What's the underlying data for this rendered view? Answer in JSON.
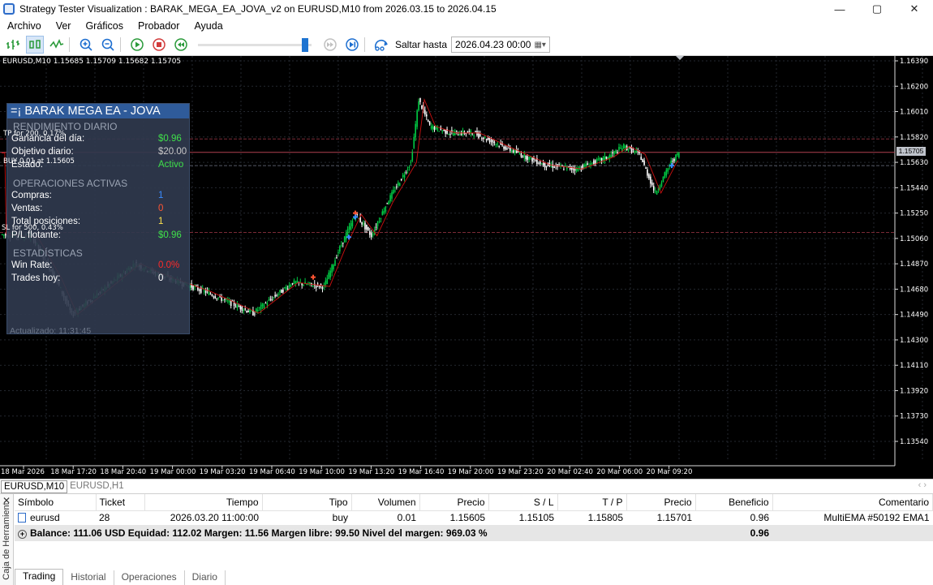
{
  "window": {
    "title": "Strategy Tester Visualization : BARAK_MEGA_EA_JOVA_v2 on EURUSD,M10 from 2026.03.15 to 2026.04.15",
    "btn_min": "—",
    "btn_max": "▢",
    "btn_close": "✕"
  },
  "menu": [
    "Archivo",
    "Ver",
    "Gráficos",
    "Probador",
    "Ayuda"
  ],
  "toolbar": {
    "saltar_label": "Saltar hasta",
    "saltar_value": "2026.04.23 00:00",
    "slider_position": 0.97
  },
  "chart": {
    "symbol_line": "EURUSD,M10  1.15685 1.15709 1.15682 1.15705",
    "price_labels": [
      "1.16390",
      "1.16200",
      "1.16010",
      "1.15820",
      "1.15630",
      "1.15440",
      "1.15250",
      "1.15060",
      "1.14870",
      "1.14680",
      "1.14490",
      "1.14300",
      "1.14110",
      "1.13920",
      "1.13730",
      "1.13540"
    ],
    "current_price": "1.15705",
    "time_labels": [
      "18 Mar 2026",
      "18 Mar 17:20",
      "18 Mar 20:40",
      "19 Mar 00:00",
      "19 Mar 03:20",
      "19 Mar 06:40",
      "19 Mar 10:00",
      "19 Mar 13:20",
      "19 Mar 16:40",
      "19 Mar 20:00",
      "19 Mar 23:20",
      "20 Mar 02:40",
      "20 Mar 06:00",
      "20 Mar 09:20"
    ],
    "annotations": {
      "tp": "TP for 200, 0.17%",
      "buy": "BUY 0.01 at 1.15605",
      "sl": "SL for 500, 0.43%"
    },
    "colors": {
      "bull": "#00cc44",
      "bear": "#ffffff",
      "ma": "#cc1111",
      "grid": "#24282f",
      "level": "#8a3340"
    }
  },
  "panel": {
    "title": "=¡ BARAK MEGA EA - JOVA",
    "sec1": "RENDIMIENTO DIARIO",
    "ganancia_label": "Ganancia del día:",
    "ganancia_value": "$0.96",
    "objetivo_label": "Objetivo diario:",
    "objetivo_value": "$20.00",
    "estado_label": "Estado:",
    "estado_value": "Activo",
    "sec2": "OPERACIONES ACTIVAS",
    "compras_label": "Compras:",
    "compras_value": "1",
    "ventas_label": "Ventas:",
    "ventas_value": "0",
    "total_label": "Total posiciones:",
    "total_value": "1",
    "pl_label": "P/L flotante:",
    "pl_value": "$0.96",
    "sec3": "ESTADÍSTICAS",
    "winrate_label": "Win Rate:",
    "winrate_value": "0.0%",
    "trades_label": "Trades hoy:",
    "trades_value": "0",
    "updated": "Actualizado: 11:31:45"
  },
  "chart_tabs": [
    "EURUSD,M10",
    "EURUSD,H1"
  ],
  "terminal": {
    "side_label": "Caja de Herramient",
    "close": "✕",
    "columns": [
      "Símbolo",
      "Ticket",
      "Tiempo",
      "Tipo",
      "Volumen",
      "Precio",
      "S / L",
      "T / P",
      "Precio",
      "Beneficio",
      "Comentario"
    ],
    "row": [
      "eurusd",
      "28",
      "2026.03.20 11:00:00",
      "buy",
      "0.01",
      "1.15605",
      "1.15105",
      "1.15805",
      "1.15701",
      "0.96",
      "MultiEMA #50192 EMA1"
    ],
    "balance_line": "Balance: 111.06 USD  Equidad: 112.02  Margen: 11.56  Margen libre: 99.50  Nivel del margen: 969.03 %",
    "balance_profit": "0.96",
    "tabs": [
      "Trading",
      "Historial",
      "Operaciones",
      "Diario"
    ]
  }
}
